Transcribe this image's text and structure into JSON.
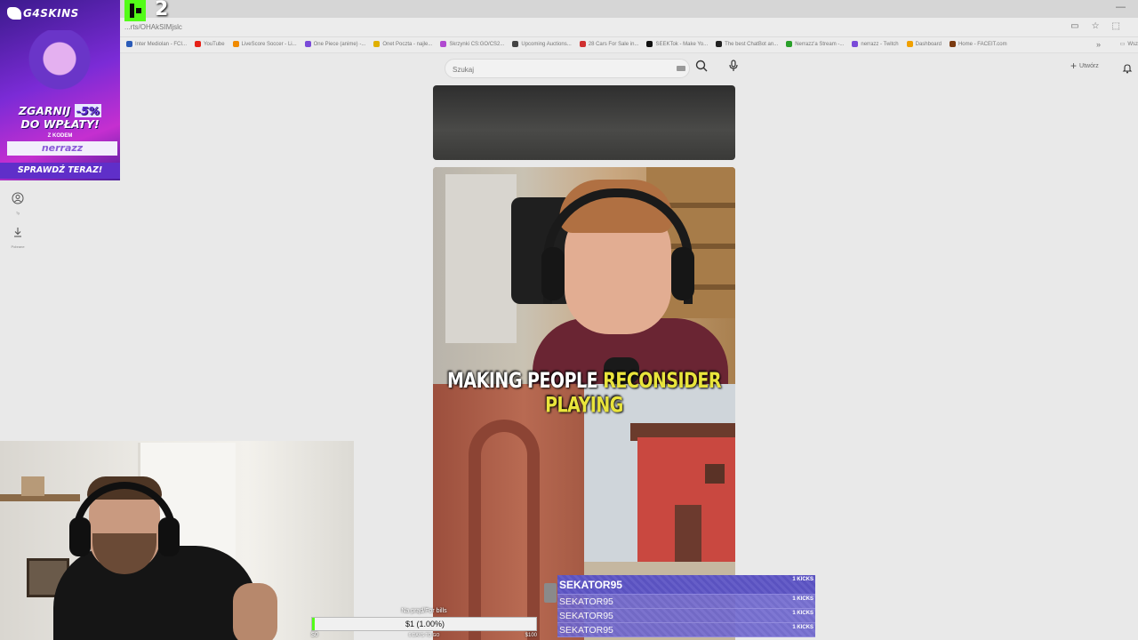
{
  "browser": {
    "url": "...rts/OHAkSIMjslc",
    "bookmarks": [
      {
        "label": "Inter Mediolan - FCI...",
        "color": "#2b5bb8"
      },
      {
        "label": "YouTube",
        "color": "#e62117"
      },
      {
        "label": "LiveScore Soccer - Li...",
        "color": "#f08a00"
      },
      {
        "label": "One Piece (anime) -...",
        "color": "#7a4bd8"
      },
      {
        "label": "Onet Poczta - najle...",
        "color": "#e0b000"
      },
      {
        "label": "Skrzynki CS:GO/CS2...",
        "color": "#b04ad0"
      },
      {
        "label": "Upcoming Auctions...",
        "color": "#444444"
      },
      {
        "label": "28 Cars For Sale in...",
        "color": "#d03030"
      },
      {
        "label": "SEEKTok - Make Yo...",
        "color": "#111111"
      },
      {
        "label": "The best ChatBot an...",
        "color": "#222222"
      },
      {
        "label": "Nerrazz'a Stream -...",
        "color": "#2aa02a"
      },
      {
        "label": "nerrazz - Twitch",
        "color": "#7a4bd8"
      },
      {
        "label": "Dashboard",
        "color": "#f0a000"
      },
      {
        "label": "Home - FACEIT.com",
        "color": "#7a3a10"
      }
    ],
    "bookmarks_overflow": "»",
    "bookmarks_folder": "Wsz"
  },
  "youtube": {
    "search_placeholder": "Szukaj",
    "create_label": "Utwórz",
    "sidebar": [
      {
        "label": "Ty"
      },
      {
        "label": "Pobrane"
      }
    ]
  },
  "short": {
    "caption_plain": "MAKING PEOPLE ",
    "caption_highlight": "RECONSIDER PLAYING"
  },
  "overlay": {
    "viewer_count": "2",
    "ad": {
      "brand": "G4SKINS",
      "line1_text": "ZGARNIJ ",
      "line1_pct": "-5%",
      "line2": "DO WPŁATY!",
      "code_label": "Z KODEM",
      "code": "nerrazz",
      "cta": "SPRAWDŹ TERAZ!"
    },
    "goal": {
      "title": "Na prąd/For bills",
      "value": "$1 (1.00%)",
      "progress_pct": 1,
      "min": "$0",
      "days": "6 DAYS TO GO",
      "max": "$100"
    },
    "kicks": [
      {
        "name": "SEKATOR95",
        "amount": "1 KICKS"
      },
      {
        "name": "SEKATOR95",
        "amount": "1 KICKS"
      },
      {
        "name": "SEKATOR95",
        "amount": "1 KICKS"
      },
      {
        "name": "SEKATOR95",
        "amount": "1 KICKS"
      }
    ]
  },
  "colors": {
    "kick_green": "#53fc18",
    "alert_purple": "#6b63c9"
  }
}
